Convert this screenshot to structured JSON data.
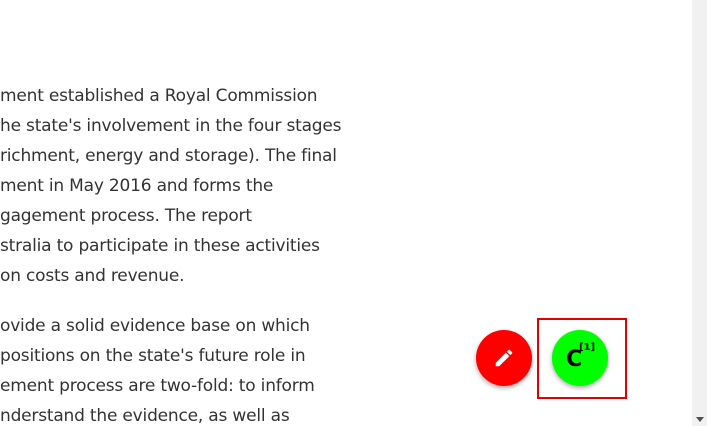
{
  "article": {
    "paragraph_1": [
      "ment established a Royal Commission",
      "he state's involvement in the four stages",
      "richment, energy and storage). The final",
      "ment in May 2016 and forms the",
      "gagement process. The report",
      "stralia to participate in these activities",
      "on costs and revenue."
    ],
    "paragraph_2": [
      "ovide a solid evidence base on which",
      " positions on the state's future role in",
      "ement process are two-fold: to inform",
      "nderstand the evidence, as well as"
    ]
  },
  "fabs": {
    "edit": {
      "icon": "pencil-icon",
      "color": "#ff0000"
    },
    "citation": {
      "letter": "C",
      "superscript": "[1]",
      "color": "#00ff00"
    }
  }
}
